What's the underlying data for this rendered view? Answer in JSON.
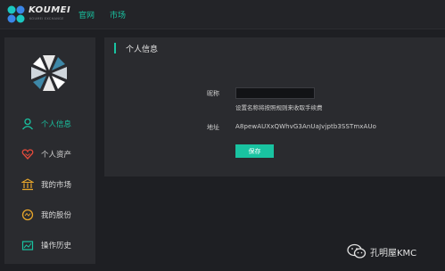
{
  "header": {
    "brand": "KOUMEI",
    "brand_sub": "KOUMEI EXCHANGE",
    "nav": [
      "官网",
      "市场"
    ]
  },
  "sidebar": {
    "items": [
      {
        "label": "个人信息",
        "icon": "person-icon",
        "active": true
      },
      {
        "label": "个人资产",
        "icon": "heart-icon"
      },
      {
        "label": "我的市场",
        "icon": "bank-icon"
      },
      {
        "label": "我的股份",
        "icon": "coin-icon"
      },
      {
        "label": "操作历史",
        "icon": "chart-icon"
      }
    ]
  },
  "main": {
    "title": "个人信息",
    "nickname_label": "昵称",
    "nickname_value": "",
    "nickname_hint": "设置名称将按照规则来收取手续费",
    "address_label": "地址",
    "address_value": "A8pewAUXxQWhvG3AnUaJvjptb3SSTmxAUo",
    "save_label": "保存"
  },
  "watermark": "孔明屋KMC",
  "colors": {
    "accent": "#19c3a1",
    "background": "#1e1f23",
    "panel": "#2a2b2f"
  }
}
